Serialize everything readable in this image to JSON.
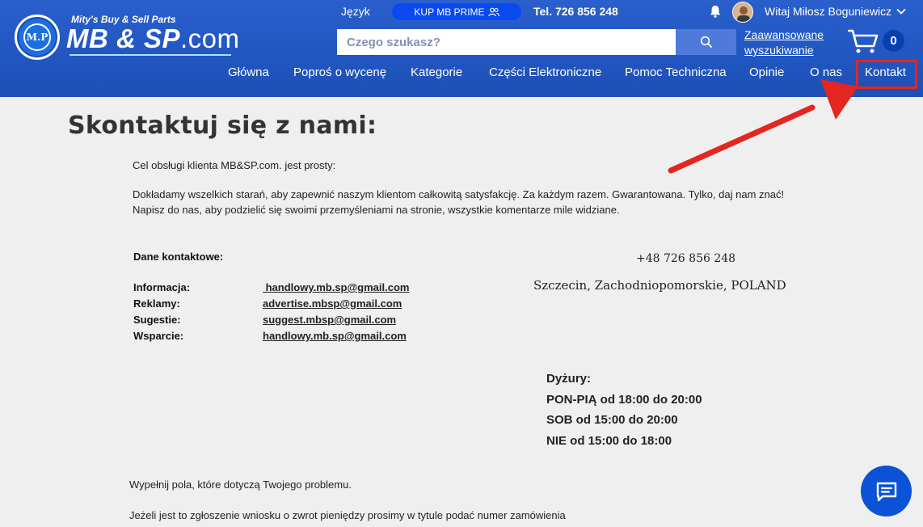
{
  "brand": {
    "tagline": "Mity's Buy & Sell Parts",
    "name": "MB & SP",
    "domain": ".com",
    "badge_text": "M.P"
  },
  "topbar": {
    "language": "Język",
    "prime_button": "KUP MB PRIME",
    "phone": "Tel. 726 856 248",
    "greeting": "Witaj Miłosz Boguniewicz"
  },
  "search": {
    "placeholder": "Czego szukasz?",
    "advanced_link": "Zaawansowane wyszukiwanie"
  },
  "cart": {
    "count": "0"
  },
  "nav": {
    "items": [
      {
        "label": "Główna"
      },
      {
        "label": "Poproś o wycenę"
      },
      {
        "label": "Kategorie"
      },
      {
        "label": "Części Elektroniczne"
      },
      {
        "label": "Pomoc Techniczna"
      },
      {
        "label": "Opinie"
      },
      {
        "label": "O nas"
      },
      {
        "label": "Kontakt"
      }
    ]
  },
  "page": {
    "title": "Skontaktuj się z nami:",
    "intro": "Cel obsługi klienta MB&SP.com. jest prosty:",
    "para1": "Dokładamy wszelkich starań, aby zapewnić naszym klientom całkowitą satysfakcję. Za każdym razem. Gwarantowana. Tylko, daj nam znać!",
    "para2": "Napisz do nas, aby podzielić się swoimi przemyśleniami na stronie, wszystkie komentarze mile widziane.",
    "contact_heading": "Dane kontaktowe:",
    "contacts": [
      {
        "label": "Informacja:",
        "email": " handlowy.mb.sp@gmail.com"
      },
      {
        "label": "Reklamy:",
        "email": "advertise.mbsp@gmail.com"
      },
      {
        "label": "Sugestie:",
        "email": "suggest.mbsp@gmail.com"
      },
      {
        "label": "Wsparcie:",
        "email": "handlowy.mb.sp@gmail.com"
      }
    ],
    "phone": "+48 726 856 248",
    "address": "Szczecin, Zachodniopomorskie, POLAND",
    "hours_heading": "Dyżury:",
    "hours": [
      "PON-PIĄ od 18:00 do 20:00",
      "SOB od 15:00 do 20:00",
      "NIE od 15:00 do 18:00"
    ],
    "form_intro": "Wypełnij pola, które dotyczą Twojego problemu.",
    "refund_note": "Jeżeli jest to zgłoszenie wniosku o zwrot pieniędzy prosimy w tytule podać numer zamówienia"
  },
  "colors": {
    "header_blue": "#2257c2",
    "highlight_red": "#e3261f",
    "chat_blue": "#0b52d6",
    "page_bg": "#efefef"
  },
  "icons": [
    "bell-icon",
    "user-group-icon",
    "search-icon",
    "cart-icon",
    "chat-icon",
    "chevron-down-icon"
  ]
}
